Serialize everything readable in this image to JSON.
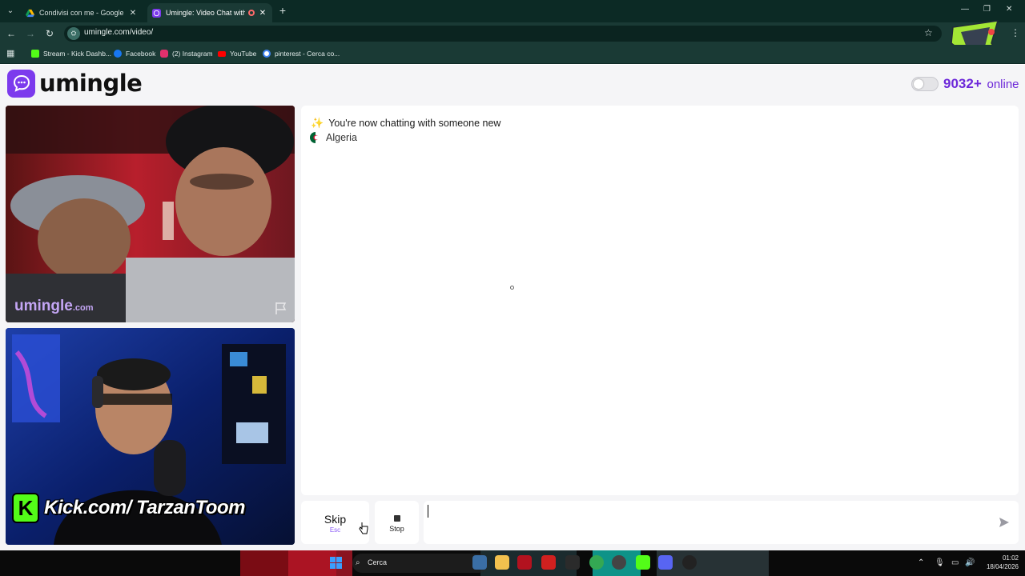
{
  "browser": {
    "tabs": [
      {
        "title": "Condivisi con me - Google Drive",
        "active": false
      },
      {
        "title": "Umingle: Video Chat with Strangers",
        "active": true
      }
    ],
    "url": "umingle.com/video/",
    "bookmarks": [
      {
        "label": "Stream - Kick Dashb...",
        "icon": "kick-icon",
        "color": "#53fc18"
      },
      {
        "label": "Facebook",
        "icon": "facebook-icon",
        "color": "#1877f2"
      },
      {
        "label": "(2) Instagram",
        "icon": "instagram-icon",
        "color": "#e1306c"
      },
      {
        "label": "YouTube",
        "icon": "youtube-icon",
        "color": "#ff0000"
      },
      {
        "label": "pinterest - Cerca co...",
        "icon": "google-icon",
        "color": "#ffffff"
      }
    ]
  },
  "site": {
    "logo_text": "umingle",
    "online_count": "9032+",
    "online_label": "online",
    "accent_color": "#7c3aed"
  },
  "stranger_video": {
    "watermark": "umingle",
    "watermark_suffix": ".com"
  },
  "self_video": {
    "overlay_text": "Kick.com/ TarzanToom",
    "kick_letter": "K"
  },
  "chat": {
    "messages": [
      {
        "icon": "sparkles-icon",
        "text": "You're now chatting with someone new"
      },
      {
        "icon": "algeria-flag-icon",
        "text": "Algeria"
      }
    ],
    "sparkle_glyph": "✨"
  },
  "controls": {
    "skip_label": "Skip",
    "skip_shortcut": "Esc",
    "stop_label": "Stop",
    "message_value": ""
  },
  "taskbar": {
    "search_label": "Cerca",
    "time": "01:02",
    "date": "18/04/2026"
  }
}
